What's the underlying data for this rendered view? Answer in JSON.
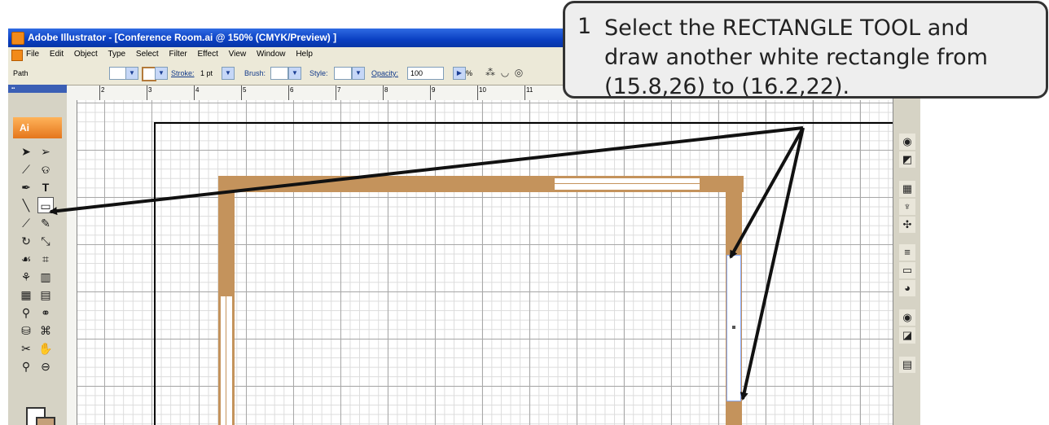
{
  "window": {
    "title": "Adobe Illustrator - [Conference Room.ai @ 150% (CMYK/Preview) ]"
  },
  "menu": {
    "items": [
      "File",
      "Edit",
      "Object",
      "Type",
      "Select",
      "Filter",
      "Effect",
      "View",
      "Window",
      "Help"
    ]
  },
  "control_bar": {
    "selection_label": "Path",
    "stroke_label": "Stroke:",
    "stroke_value": "1 pt",
    "brush_label": "Brush:",
    "style_label": "Style:",
    "opacity_label": "Opacity:",
    "opacity_value": "100",
    "opacity_unit": "%"
  },
  "ruler": {
    "h_numbers": [
      "2",
      "3",
      "4",
      "5",
      "6",
      "7",
      "8",
      "9",
      "10",
      "11"
    ]
  },
  "toolbox": {
    "logo_text": "Ai"
  },
  "callout": {
    "step_number": "1",
    "line1": "Select the RECTANGLE TOOL and",
    "line2": "draw another white rectangle from",
    "line3": "(15.8,26) to (16.2,22)."
  },
  "colors": {
    "wall_brown": "#c4935c",
    "title_blue": "#0a3fc1",
    "callout_bg": "#eeeeee"
  },
  "icons": [
    "selection-icon",
    "direct-selection-icon",
    "magic-wand-icon",
    "lasso-icon",
    "pen-icon",
    "type-icon",
    "line-icon",
    "rectangle-icon",
    "paintbrush-icon",
    "pencil-icon",
    "rotate-icon",
    "scale-icon",
    "warp-icon",
    "symbol-sprayer-icon",
    "graph-icon",
    "mesh-icon",
    "gradient-icon",
    "eyedropper-icon",
    "blend-icon",
    "scissors-icon",
    "hand-icon",
    "zoom-icon"
  ]
}
